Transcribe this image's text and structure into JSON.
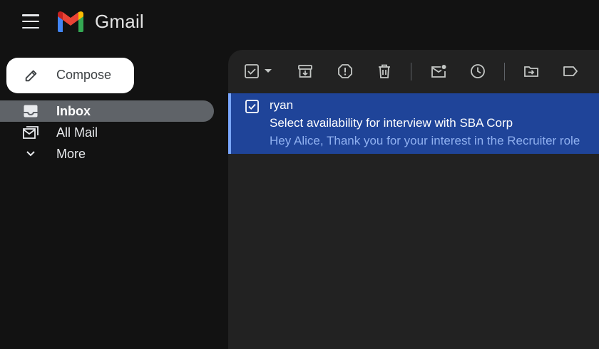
{
  "app": {
    "brand": "Gmail"
  },
  "compose": {
    "label": "Compose"
  },
  "nav": {
    "items": [
      {
        "label": "Inbox",
        "icon": "inbox-icon",
        "active": true
      },
      {
        "label": "All Mail",
        "icon": "all-mail-icon",
        "active": false
      },
      {
        "label": "More",
        "icon": "chevron-down-icon",
        "active": false
      }
    ]
  },
  "toolbar": {
    "icons": [
      "select-all-checkbox-icon",
      "select-dropdown-icon",
      "archive-icon",
      "report-spam-icon",
      "delete-icon",
      "mark-unread-icon",
      "snooze-icon",
      "move-to-icon",
      "label-icon"
    ]
  },
  "email": {
    "sender": "ryan",
    "subject": "Select availability for interview with SBA Corp",
    "snippet": "Hey Alice, Thank you for your interest in the Recruiter role"
  },
  "colors": {
    "background": "#121212",
    "main_panel": "#222222",
    "selected_row": "#1f4499",
    "active_nav": "#5f6368",
    "compose_bg": "#ffffff"
  }
}
